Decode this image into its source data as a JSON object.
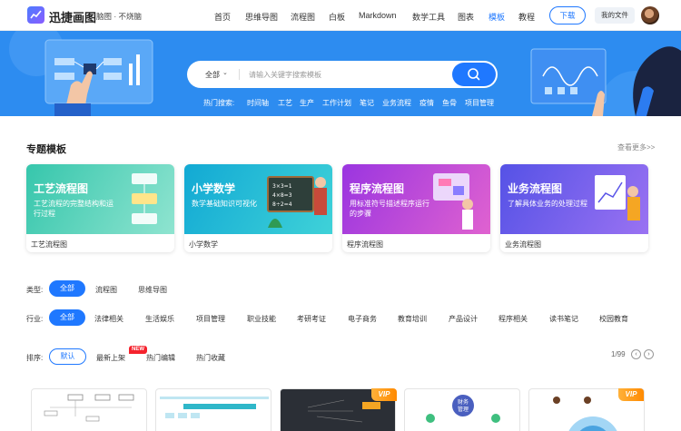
{
  "header": {
    "brand": "迅捷画图",
    "slogan": "脑图 · 不烧脑",
    "nav": [
      "首页",
      "思维导图",
      "流程图",
      "白板",
      "Markdown",
      "数学工具",
      "图表",
      "模板",
      "教程"
    ],
    "active_nav": "模板",
    "download_label": "下载",
    "my_files_label": "我的文件"
  },
  "search": {
    "scope": "全部",
    "placeholder": "请输入关键字搜索模板",
    "hot_label": "热门搜索:",
    "hot_terms": [
      "时间轴",
      "工艺",
      "生产",
      "工作计划",
      "笔记",
      "业务流程",
      "疫情",
      "鱼骨",
      "项目管理"
    ]
  },
  "featured": {
    "title": "专题模板",
    "see_more": "查看更多>>",
    "cards": [
      {
        "title": "工艺流程图",
        "desc": "工艺流程的完整结构和运行过程",
        "label": "工艺流程图",
        "color1": "#3ec9b0",
        "color2": "#7ee0c9"
      },
      {
        "title": "小学数学",
        "desc": "数学基础知识可视化",
        "label": "小学数学",
        "color1": "#1fb3d6",
        "color2": "#45d0d8"
      },
      {
        "title": "程序流程图",
        "desc": "用标准符号描述程序运行的步骤",
        "label": "程序流程图",
        "color1": "#a43fe0",
        "color2": "#d25bd8"
      },
      {
        "title": "业务流程图",
        "desc": "了解具体业务的处理过程",
        "label": "业务流程图",
        "color1": "#5a55e8",
        "color2": "#8e6cf0"
      }
    ]
  },
  "filters": {
    "type_label": "类型:",
    "types": [
      "全部",
      "流程图",
      "思维导图"
    ],
    "industry_label": "行业:",
    "industries": [
      "全部",
      "法律相关",
      "生活娱乐",
      "项目管理",
      "职业技能",
      "考研考证",
      "电子商务",
      "教育培训",
      "产品设计",
      "程序相关",
      "读书笔记",
      "校园教育"
    ],
    "sort_label": "排序:",
    "sorts": [
      "默认",
      "最新上架",
      "热门编辑",
      "热门收藏"
    ],
    "new_badge": "NEW",
    "page": "1/99"
  },
  "thumbs": {
    "vip_label": "VIP",
    "finance_text": "财务\n管理"
  },
  "colors": {
    "accent": "#1f78ff",
    "banner": "#2d8cf0"
  }
}
